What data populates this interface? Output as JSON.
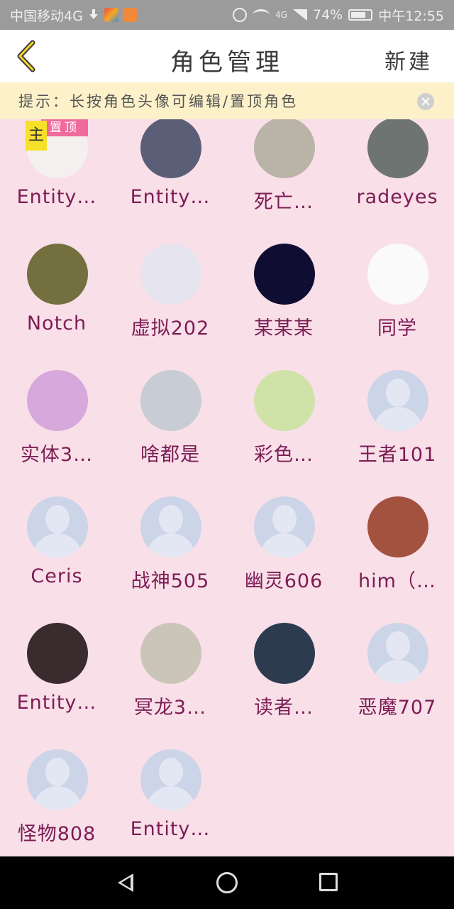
{
  "status_bar": {
    "carrier": "中国移动4G",
    "signal_label": "4G",
    "battery": "74%",
    "time": "中午12:55"
  },
  "header": {
    "title": "角色管理",
    "new_label": "新建"
  },
  "tip": {
    "text": "提示：长按角色头像可编辑/置顶角色"
  },
  "badges": {
    "pinned": "置顶",
    "main": "主"
  },
  "roles": [
    {
      "name": "Entity…",
      "avatar": "sketch-boy",
      "color": "#f4f0f0",
      "pinned": true,
      "main": true
    },
    {
      "name": "Entity…",
      "avatar": "anime-red-eyes",
      "color": "#5b5e77"
    },
    {
      "name": "死亡…",
      "avatar": "wolf-sketch",
      "color": "#b9b3a8"
    },
    {
      "name": "radeyes",
      "avatar": "grey-anime",
      "color": "#6d7472"
    },
    {
      "name": "Notch",
      "avatar": "notch-art",
      "color": "#746f3f"
    },
    {
      "name": "虚拟202",
      "avatar": "white-cat-girl",
      "color": "#e6e4ee"
    },
    {
      "name": "某某某",
      "avatar": "dark-navy-circle",
      "color": "#100d33"
    },
    {
      "name": "同学",
      "avatar": "meme-face",
      "color": "#fafafa"
    },
    {
      "name": "实体3…",
      "avatar": "two-kids",
      "color": "#d6a8dc"
    },
    {
      "name": "啥都是",
      "avatar": "long-hair-girl",
      "color": "#c8ccd4"
    },
    {
      "name": "彩色…",
      "avatar": "green-meme",
      "color": "#cfe3a8"
    },
    {
      "name": "王者101",
      "avatar": "default-avatar",
      "color": "#ccd4e8"
    },
    {
      "name": "Ceris",
      "avatar": "default-avatar",
      "color": "#ccd4e8"
    },
    {
      "name": "战神505",
      "avatar": "default-avatar",
      "color": "#ccd4e8"
    },
    {
      "name": "幽灵606",
      "avatar": "default-avatar",
      "color": "#ccd4e8"
    },
    {
      "name": "him（…",
      "avatar": "boy-red-scarf",
      "color": "#a3523f"
    },
    {
      "name": "Entity…",
      "avatar": "dark-anime",
      "color": "#3a2b2e"
    },
    {
      "name": "冥龙3…",
      "avatar": "paper-sketch",
      "color": "#cbc4b8"
    },
    {
      "name": "读者…",
      "avatar": "group-anime",
      "color": "#2c3b4e"
    },
    {
      "name": "恶魔707",
      "avatar": "default-avatar",
      "color": "#ccd4e8"
    },
    {
      "name": "怪物808",
      "avatar": "default-avatar",
      "color": "#ccd4e8"
    },
    {
      "name": "Entity…",
      "avatar": "default-avatar",
      "color": "#ccd4e8"
    }
  ],
  "nav": {
    "back_icon": "triangle-back-icon",
    "home_icon": "circle-home-icon",
    "recent_icon": "square-recent-icon"
  }
}
